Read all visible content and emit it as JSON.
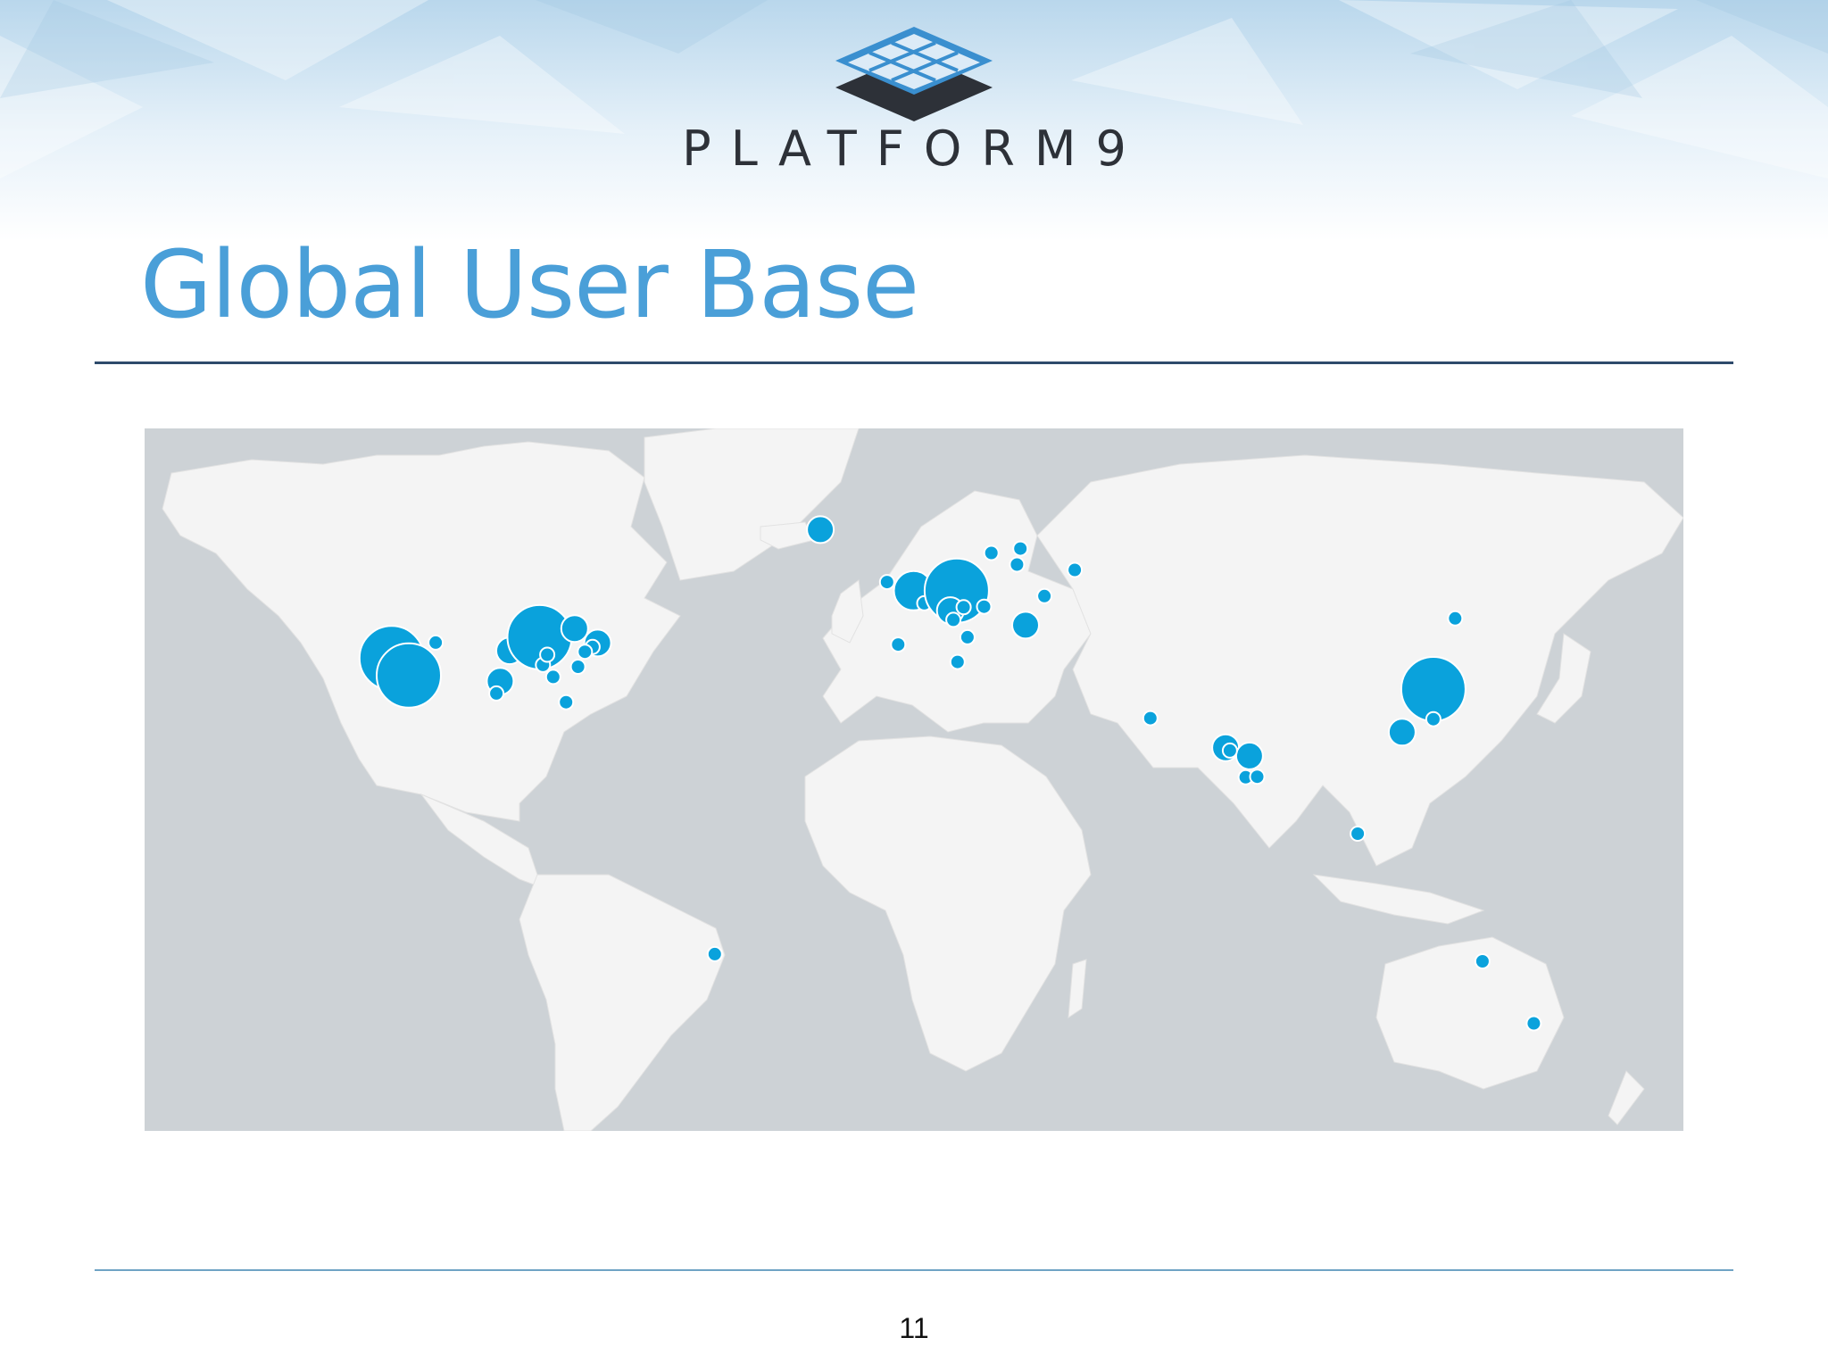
{
  "slide": {
    "brand": "PLATFORM9",
    "title": "Global User Base",
    "page_number": "11"
  },
  "colors": {
    "title": "#4a9fd8",
    "rule_top": "#2e4a6b",
    "rule_bottom": "#6fa3c4",
    "ocean": "#cdd2d6",
    "land": "#f3f3f3",
    "marker": "#0aa2dc"
  },
  "map": {
    "projection": "equirectangular",
    "markers": [
      {
        "place": "San Francisco Bay Area",
        "lon": -122.2,
        "lat": 37.6,
        "size": "xl"
      },
      {
        "place": "Los Angeles",
        "lon": -118.2,
        "lat": 34.0,
        "size": "xl"
      },
      {
        "place": "Salt Lake City",
        "lon": -111.9,
        "lat": 40.8,
        "size": "s"
      },
      {
        "place": "Dallas",
        "lon": -96.8,
        "lat": 32.8,
        "size": "m"
      },
      {
        "place": "Austin",
        "lon": -97.7,
        "lat": 30.3,
        "size": "s"
      },
      {
        "place": "Kansas City",
        "lon": -94.6,
        "lat": 39.1,
        "size": "m"
      },
      {
        "place": "Chicago",
        "lon": -87.6,
        "lat": 41.9,
        "size": "xl"
      },
      {
        "place": "Toronto",
        "lon": -79.4,
        "lat": 43.7,
        "size": "m"
      },
      {
        "place": "New York",
        "lon": -74.0,
        "lat": 40.7,
        "size": "m"
      },
      {
        "place": "Philadelphia",
        "lon": -75.2,
        "lat": 39.9,
        "size": "s"
      },
      {
        "place": "Washington DC",
        "lon": -77.0,
        "lat": 38.9,
        "size": "s"
      },
      {
        "place": "Raleigh",
        "lon": -78.6,
        "lat": 35.8,
        "size": "s"
      },
      {
        "place": "Nashville",
        "lon": -86.8,
        "lat": 36.2,
        "size": "s"
      },
      {
        "place": "Atlanta",
        "lon": -84.4,
        "lat": 33.7,
        "size": "s"
      },
      {
        "place": "Louisville",
        "lon": -85.8,
        "lat": 38.3,
        "size": "s"
      },
      {
        "place": "Orlando",
        "lon": -81.4,
        "lat": 28.5,
        "size": "s"
      },
      {
        "place": "Iceland",
        "lon": -21.9,
        "lat": 64.1,
        "size": "m"
      },
      {
        "place": "Dublin",
        "lon": -6.3,
        "lat": 53.3,
        "size": "s"
      },
      {
        "place": "London",
        "lon": -0.1,
        "lat": 51.5,
        "size": "l"
      },
      {
        "place": "Paris",
        "lon": 2.4,
        "lat": 48.9,
        "size": "s"
      },
      {
        "place": "Madrid",
        "lon": -3.7,
        "lat": 40.4,
        "size": "s"
      },
      {
        "place": "Germany",
        "lon": 10.0,
        "lat": 51.5,
        "size": "xl"
      },
      {
        "place": "Switzerland",
        "lon": 8.5,
        "lat": 47.4,
        "size": "m"
      },
      {
        "place": "Milan",
        "lon": 9.2,
        "lat": 45.5,
        "size": "s"
      },
      {
        "place": "Munich",
        "lon": 11.6,
        "lat": 48.1,
        "size": "s"
      },
      {
        "place": "Vienna",
        "lon": 16.4,
        "lat": 48.2,
        "size": "s"
      },
      {
        "place": "Rome",
        "lon": 12.5,
        "lat": 41.9,
        "size": "s"
      },
      {
        "place": "Stockholm",
        "lon": 18.1,
        "lat": 59.3,
        "size": "s"
      },
      {
        "place": "Helsinki",
        "lon": 24.9,
        "lat": 60.2,
        "size": "s"
      },
      {
        "place": "Riga",
        "lon": 24.1,
        "lat": 56.9,
        "size": "s"
      },
      {
        "place": "Moscow",
        "lon": 37.6,
        "lat": 55.8,
        "size": "s"
      },
      {
        "place": "Kyiv",
        "lon": 30.5,
        "lat": 50.4,
        "size": "s"
      },
      {
        "place": "Romania",
        "lon": 26.1,
        "lat": 44.4,
        "size": "m"
      },
      {
        "place": "Tunis",
        "lon": 10.2,
        "lat": 36.8,
        "size": "s"
      },
      {
        "place": "Dubai",
        "lon": 55.3,
        "lat": 25.2,
        "size": "s"
      },
      {
        "place": "Mumbai",
        "lon": 72.9,
        "lat": 19.1,
        "size": "m"
      },
      {
        "place": "Hyderabad",
        "lon": 78.5,
        "lat": 17.4,
        "size": "m"
      },
      {
        "place": "Bangalore",
        "lon": 77.6,
        "lat": 13.0,
        "size": "s"
      },
      {
        "place": "Chennai",
        "lon": 80.3,
        "lat": 13.1,
        "size": "s"
      },
      {
        "place": "Pune",
        "lon": 73.9,
        "lat": 18.5,
        "size": "s"
      },
      {
        "place": "Singapore",
        "lon": 103.8,
        "lat": 1.35,
        "size": "s"
      },
      {
        "place": "Hong Kong",
        "lon": 114.2,
        "lat": 22.3,
        "size": "m"
      },
      {
        "place": "Shanghai",
        "lon": 121.5,
        "lat": 31.2,
        "size": "xl"
      },
      {
        "place": "Taipei",
        "lon": 121.5,
        "lat": 25.0,
        "size": "s"
      },
      {
        "place": "Harbin",
        "lon": 126.6,
        "lat": 45.8,
        "size": "s"
      },
      {
        "place": "Sao Paulo",
        "lon": -46.6,
        "lat": -23.5,
        "size": "s"
      },
      {
        "place": "Australia",
        "lon": 133.0,
        "lat": -25.0,
        "size": "s"
      },
      {
        "place": "Melbourne",
        "lon": 145.0,
        "lat": -37.8,
        "size": "s"
      }
    ]
  }
}
